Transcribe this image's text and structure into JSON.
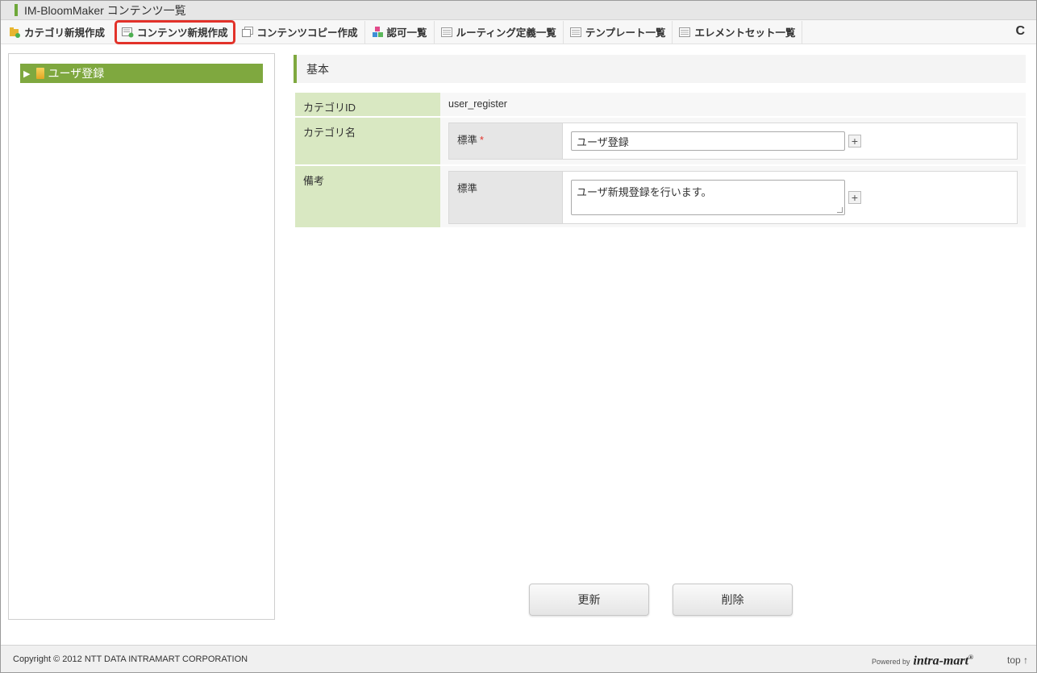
{
  "title": "IM-BloomMaker コンテンツ一覧",
  "toolbar": {
    "items": [
      {
        "label": "カテゴリ新規作成",
        "icon": "folder-add-icon"
      },
      {
        "label": "コンテンツ新規作成",
        "icon": "content-add-icon"
      },
      {
        "label": "コンテンツコピー作成",
        "icon": "copy-icon"
      },
      {
        "label": "認可一覧",
        "icon": "authorization-icon"
      },
      {
        "label": "ルーティング定義一覧",
        "icon": "list-icon"
      },
      {
        "label": "テンプレート一覧",
        "icon": "list-icon"
      },
      {
        "label": "エレメントセット一覧",
        "icon": "list-icon"
      }
    ],
    "reload": "C"
  },
  "tree": {
    "selected_label": "ユーザ登録"
  },
  "section": {
    "title": "基本"
  },
  "form": {
    "category_id_label": "カテゴリID",
    "category_id_value": "user_register",
    "category_name_label": "カテゴリ名",
    "category_name_locale": "標準",
    "category_name_required": "*",
    "category_name_value": "ユーザ登録",
    "remarks_label": "備考",
    "remarks_locale": "標準",
    "remarks_value": "ユーザ新規登録を行います。",
    "plus": "+"
  },
  "buttons": {
    "update": "更新",
    "delete": "削除"
  },
  "footer": {
    "copyright": "Copyright © 2012 NTT DATA INTRAMART CORPORATION",
    "powered_by": "Powered by",
    "logo": "intra-mart",
    "top": "top ↑"
  },
  "colors": {
    "accent_green": "#7fa83f",
    "label_green": "#d9e8c2",
    "highlight_red": "#e2322a"
  }
}
